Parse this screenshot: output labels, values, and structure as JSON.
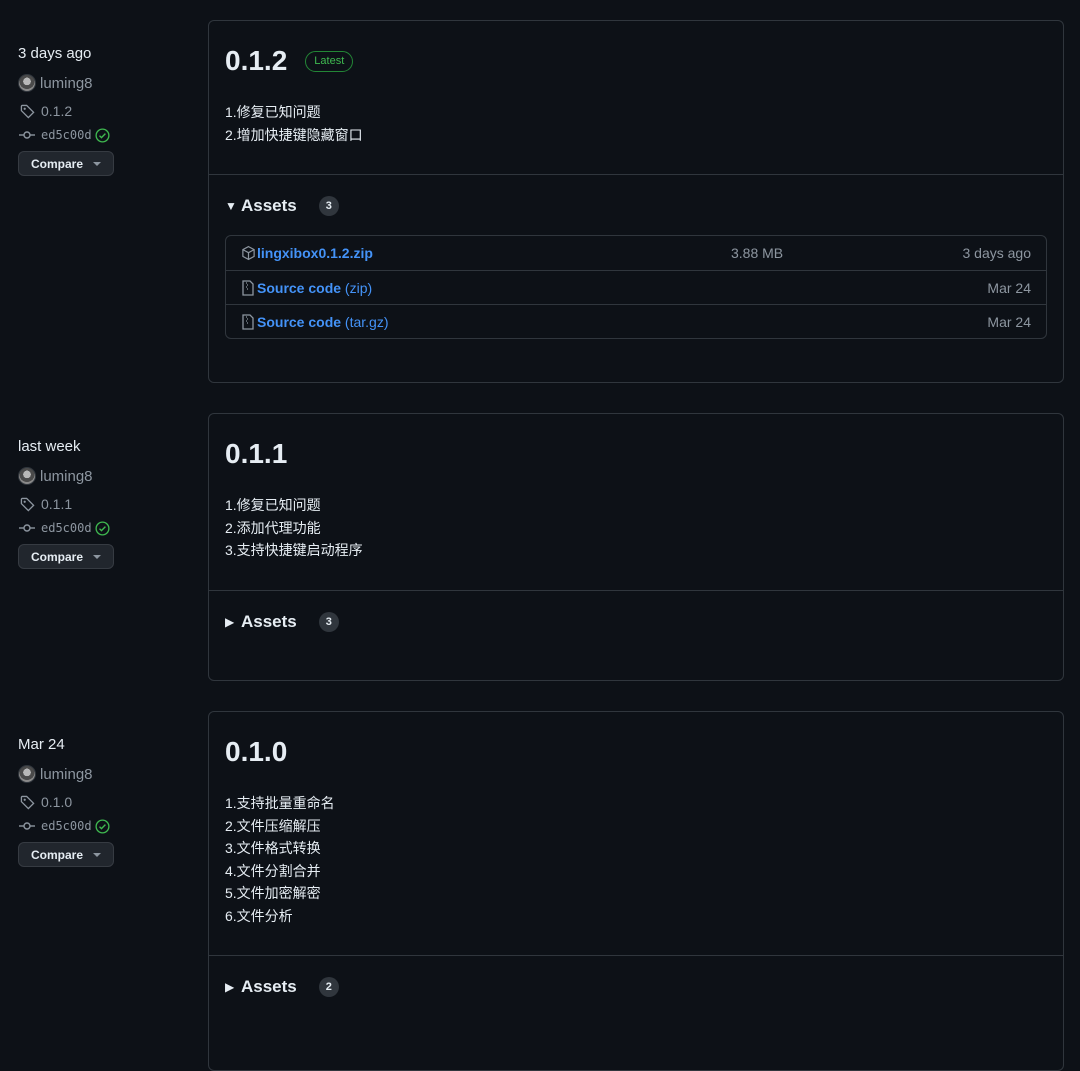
{
  "releases": [
    {
      "date": "3 days ago",
      "author": "luming8",
      "tag": "0.1.2",
      "commit": "ed5c00d",
      "compare_label": "Compare",
      "version": "0.1.2",
      "badge": "Latest",
      "notes": [
        "1.修复已知问题",
        "2.增加快捷键隐藏窗口"
      ],
      "assets_label": "Assets",
      "assets_count": "3",
      "assets_expanded": true,
      "assets": [
        {
          "name": "lingxibox0.1.2.zip",
          "icon": "package-icon",
          "size": "3.88 MB",
          "date": "3 days ago"
        },
        {
          "name": "Source code",
          "suffix": "(zip)",
          "icon": "file-zip-icon",
          "size": "",
          "date": "Mar 24"
        },
        {
          "name": "Source code",
          "suffix": "(tar.gz)",
          "icon": "file-zip-icon",
          "size": "",
          "date": "Mar 24"
        }
      ]
    },
    {
      "date": "last week",
      "author": "luming8",
      "tag": "0.1.1",
      "commit": "ed5c00d",
      "compare_label": "Compare",
      "version": "0.1.1",
      "notes": [
        "1.修复已知问题",
        "2.添加代理功能",
        "3.支持快捷键启动程序"
      ],
      "assets_label": "Assets",
      "assets_count": "3",
      "assets_expanded": false
    },
    {
      "date": "Mar 24",
      "author": "luming8",
      "tag": "0.1.0",
      "commit": "ed5c00d",
      "compare_label": "Compare",
      "version": "0.1.0",
      "notes": [
        "1.支持批量重命名",
        "2.文件压缩解压",
        "3.文件格式转换",
        "4.文件分割合并",
        "5.文件加密解密",
        "6.文件分析"
      ],
      "assets_label": "Assets",
      "assets_count": "2",
      "assets_expanded": false
    }
  ],
  "colors": {
    "background": "#0d1117",
    "border": "#30363d",
    "link": "#4493f8",
    "success": "#3fb950",
    "muted": "#8d96a0"
  }
}
